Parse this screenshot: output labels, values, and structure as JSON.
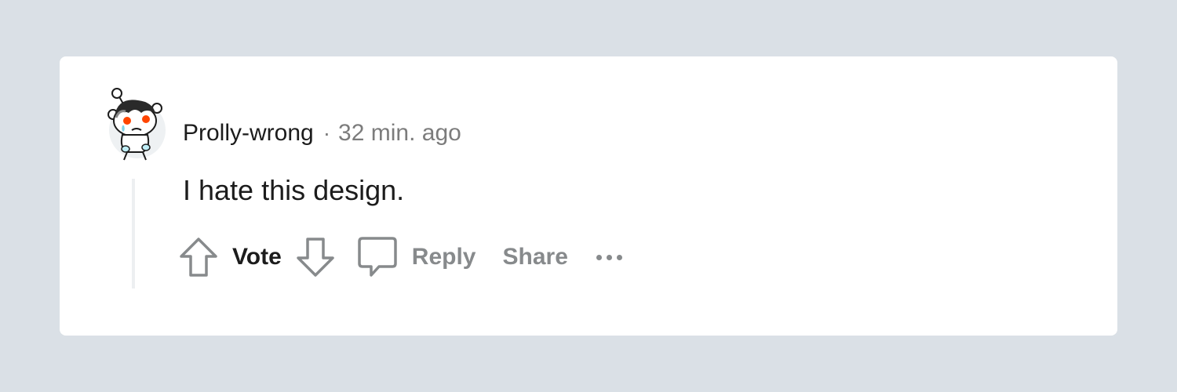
{
  "comment": {
    "author": "Prolly-wrong",
    "separator": "·",
    "time": "32 min. ago",
    "body": "I hate this design."
  },
  "actions": {
    "vote_label": "Vote",
    "reply_label": "Reply",
    "share_label": "Share"
  },
  "icons": {
    "upvote": "upvote-arrow-icon",
    "downvote": "downvote-arrow-icon",
    "reply": "speech-bubble-icon",
    "more": "more-options-icon"
  },
  "colors": {
    "background": "#dae0e6",
    "card": "#ffffff",
    "text_primary": "#1c1c1c",
    "text_secondary": "#878a8c",
    "avatar_eyes": "#ff4500"
  }
}
